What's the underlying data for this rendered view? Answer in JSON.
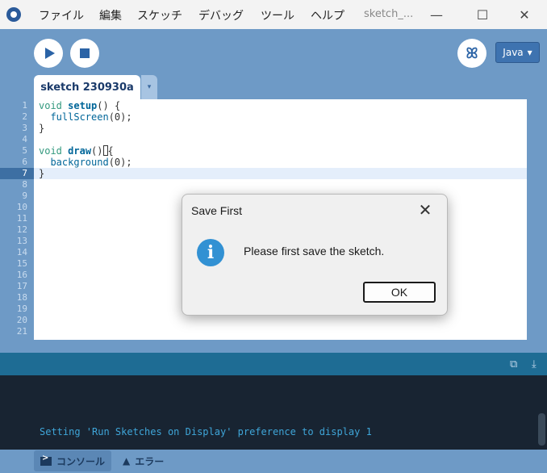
{
  "menu": [
    "ファイル",
    "編集",
    "スケッチ",
    "デバッグ",
    "ツール",
    "ヘルプ"
  ],
  "window_title": "sketch_...",
  "window_controls": {
    "minimize": "—",
    "maximize": "☐",
    "close": "✕"
  },
  "toolbar": {
    "mode_label": "Java",
    "mode_arrow": "▾"
  },
  "tab": {
    "name": "sketch 230930a",
    "menu_arrow": "▾"
  },
  "editor": {
    "line_numbers": [
      "1",
      "2",
      "3",
      "4",
      "5",
      "6",
      "7",
      "8",
      "9",
      "10",
      "11",
      "12",
      "13",
      "14",
      "15",
      "16",
      "17",
      "18",
      "19",
      "20",
      "21"
    ],
    "current_line": 7
  },
  "console": {
    "message": "Setting 'Run Sketches on Display' preference to display 1"
  },
  "bottom_tabs": {
    "console": "コンソール",
    "errors": "エラー",
    "errors_icon": "▲"
  },
  "dialog": {
    "title": "Save First",
    "message": "Please first save the sketch.",
    "ok_label": "OK",
    "close_glyph": "✕",
    "info_glyph": "i"
  },
  "colors": {
    "accent": "#6e9ac6",
    "console_bg": "#182432",
    "console_text": "#3fa6d9",
    "info": "#3291d3"
  }
}
